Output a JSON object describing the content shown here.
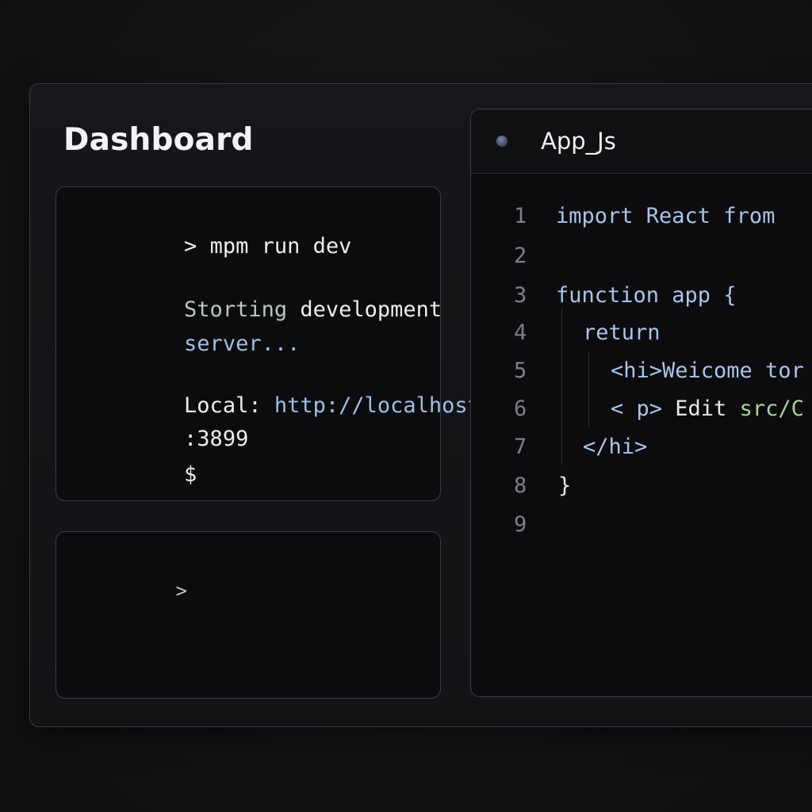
{
  "dashboard": {
    "title": "Dashboard"
  },
  "terminal_main": {
    "command_prompt": ">",
    "command": "mpm run dev",
    "status_word": "Storting",
    "status_rest": "development",
    "status_line2": "server...",
    "local_label": "Local:",
    "local_url": "http://localhost",
    "local_port": ":3899",
    "shell_prompt": "$"
  },
  "terminal_secondary": {
    "prompt": ">"
  },
  "editor": {
    "file_name": "App_Js",
    "line_numbers": [
      "1",
      "2",
      "3",
      "4",
      "5",
      "6",
      "7",
      "8",
      "9"
    ],
    "lines": {
      "l1": "import React from",
      "l3": "function app {",
      "l4": "return",
      "l5": "<hi>Weicome tor",
      "l6_tag": "< p>",
      "l6_text": " Edit ",
      "l6_path": "src/C",
      "l7": "</hi>",
      "l8": "}"
    }
  },
  "colors": {
    "background": "#121314",
    "panel": "#0c0c0e",
    "border": "#3b3d42",
    "keyword": "#a9c4ea",
    "link": "#9fbfe6",
    "string": "#a8d49a",
    "muted_green": "#b8c8bc",
    "line_number": "#7d8086"
  },
  "icons": {
    "editor_tab_dot": "status-dot-icon"
  }
}
